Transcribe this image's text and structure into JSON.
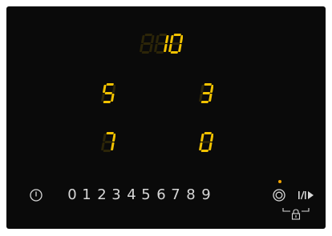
{
  "zones": {
    "rear_center": {
      "digits": [
        "1",
        "0"
      ],
      "dim_leading": true
    },
    "front_left": {
      "digits": [
        "5"
      ],
      "dim_leading": false
    },
    "front_right": {
      "digits": [
        "3"
      ],
      "dim_leading": false
    },
    "rear_left": {
      "digits": [
        "7"
      ],
      "dim_leading": false
    },
    "rear_right": {
      "digits": [
        "0"
      ],
      "dim_leading": false
    }
  },
  "controls": {
    "power_icon": "power-icon",
    "power_level_keys": [
      "0",
      "1",
      "2",
      "3",
      "4",
      "5",
      "6",
      "7",
      "8",
      "9"
    ],
    "timer_icon": "timer-icon",
    "pause_icon": "pause-play-icon",
    "lock_icon": "lock-icon"
  },
  "colors": {
    "display_on": "#f2c200",
    "display_off": "#2c2508",
    "panel": "#0a0a0a",
    "keys": "#d8d8d8",
    "indicator": "#f2a400"
  }
}
